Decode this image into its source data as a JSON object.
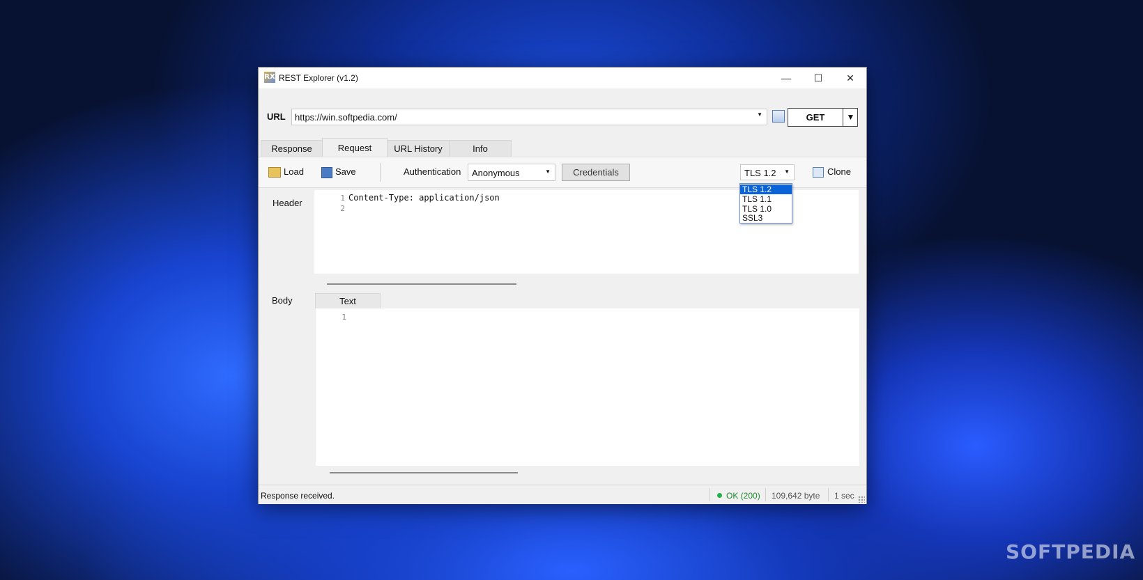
{
  "window": {
    "title": "REST Explorer  (v1.2)",
    "app_icon": "RX",
    "minimize_glyph": "—",
    "maximize_glyph": "☐",
    "close_glyph": "✕"
  },
  "url_bar": {
    "label": "URL",
    "value": "https://win.softpedia.com/",
    "method": "GET"
  },
  "tabs": [
    "Response",
    "Request",
    "URL History",
    "Info"
  ],
  "active_tab": "Request",
  "toolbar": {
    "load": "Load",
    "save": "Save",
    "auth_label": "Authentication",
    "auth_value": "Anonymous",
    "credentials": "Credentials",
    "tls_value": "TLS 1.2",
    "clone": "Clone"
  },
  "header_section": {
    "label": "Header",
    "lines": [
      "1",
      "2"
    ],
    "code": "Content-Type: application/json"
  },
  "body_section": {
    "label": "Body",
    "tab": "Text",
    "lines": [
      "1"
    ]
  },
  "status": {
    "message": "Response received.",
    "code": "OK (200)",
    "size": "109,642 byte",
    "time": "1 sec"
  },
  "tls_dropdown": {
    "options": [
      "TLS 1.2",
      "TLS 1.1",
      "TLS 1.0",
      "SSL3"
    ],
    "selected": "TLS 1.2"
  },
  "watermark": "SOFTPEDIA",
  "colors": {
    "selection": "#0a64d8",
    "ok": "#1f8a2e",
    "ok_dot": "#22b14c"
  }
}
